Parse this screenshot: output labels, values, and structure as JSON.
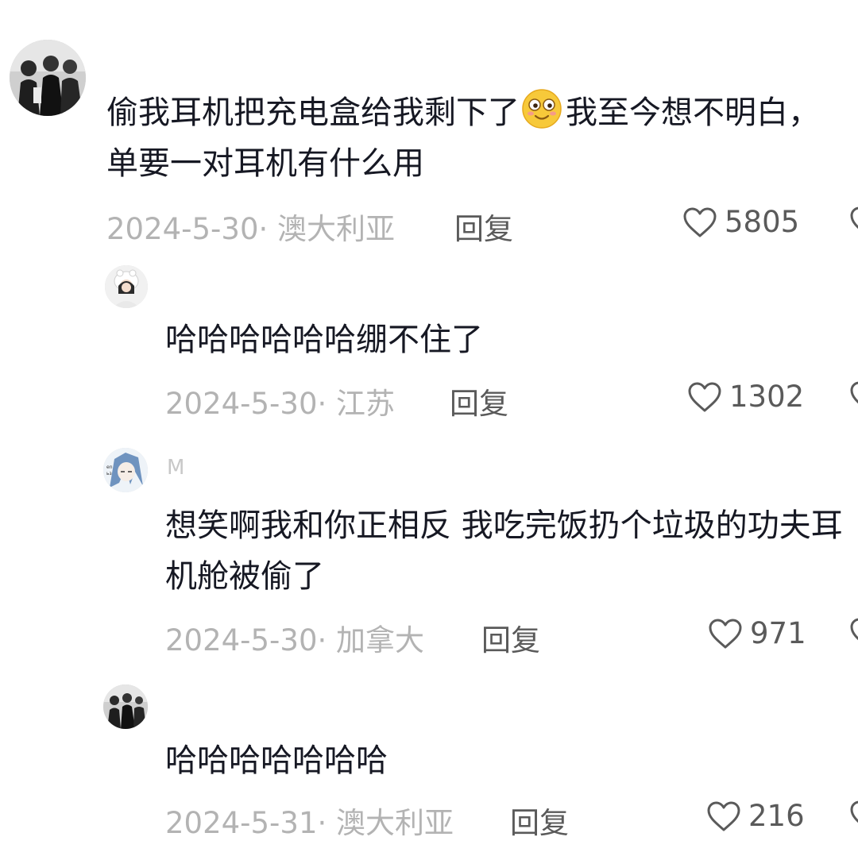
{
  "comments": [
    {
      "username": "",
      "text_part1": "偷我耳机把充电盒给我剩下了",
      "emoji": "smiley-icon",
      "text_part2": "我至今想不明白，单要一对耳机有什么用",
      "meta": "2024-5-30· 澳大利亚",
      "reply": "回复",
      "likes": "5805"
    },
    {
      "username": "",
      "text": "哈哈哈哈哈哈绷不住了",
      "meta": "2024-5-30· 江苏",
      "reply": "回复",
      "likes": "1302"
    },
    {
      "username": "M",
      "text": "想笑啊我和你正相反 我吃完饭扔个垃圾的功夫耳机舱被偷了",
      "meta": "2024-5-30· 加拿大",
      "reply": "回复",
      "likes": "971"
    },
    {
      "username": "",
      "text": "哈哈哈哈哈哈哈",
      "meta": "2024-5-31· 澳大利亚",
      "reply": "回复",
      "likes": "216"
    }
  ],
  "colors": {
    "text": "#161823",
    "meta": "#b3b3b3",
    "action": "#5a5a5a"
  },
  "icons": [
    "heart-outline-icon",
    "smiley-icon"
  ]
}
